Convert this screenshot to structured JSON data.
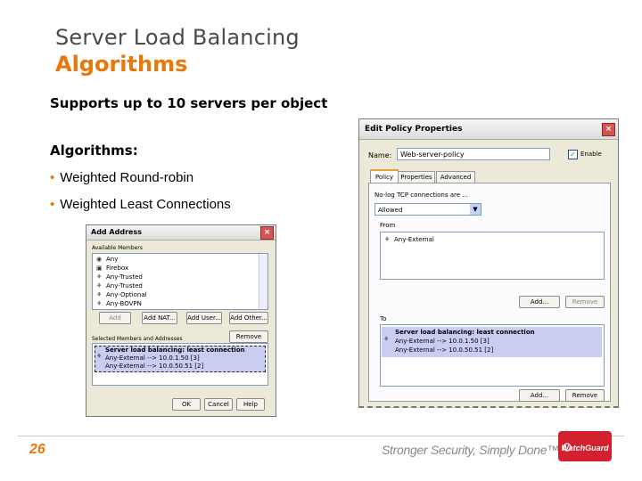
{
  "slide": {
    "title_line1": "Server Load Balancing",
    "title_line2": "Algorithms",
    "subtitle": "Supports up to 10 servers per object",
    "algorithms_heading": "Algorithms:",
    "bullets": [
      "Weighted Round-robin",
      "Weighted Least Connections"
    ],
    "page_number": "26",
    "tagline": "Stronger Security, Simply Done™",
    "accent_color": "#e8780c"
  },
  "add_address": {
    "title": "Add Address",
    "available_label": "Available Members",
    "members": [
      "Any",
      "Firebox",
      "Any-Trusted",
      "Any-Trusted",
      "Any-Optional",
      "Any-BOVPN"
    ],
    "buttons": {
      "add": "Add",
      "add_nat": "Add NAT...",
      "add_user": "Add User...",
      "add_other": "Add Other...",
      "remove": "Remove",
      "ok": "OK",
      "cancel": "Cancel",
      "help": "Help"
    },
    "selected_label": "Selected Members and Addresses",
    "selected_rows": [
      "Server load balancing: least connection",
      "Any-External --> 10.0.1.50 [3]",
      "Any-External --> 10.0.50.51 [2]"
    ]
  },
  "policy_props": {
    "title": "Edit Policy Properties",
    "name_label": "Name:",
    "name_value": "Web-server-policy",
    "enable_label": "Enable",
    "tabs": [
      "Policy",
      "Properties",
      "Advanced"
    ],
    "conn_label": "No-log TCP connections are ...",
    "conn_value": "Allowed",
    "from_label": "From",
    "from_items": [
      "Any-External"
    ],
    "to_label": "To",
    "to_items": [
      "Server load balancing: least connection",
      "Any-External --> 10.0.1.50 [3]",
      "Any-External --> 10.0.50.51 [2]"
    ],
    "buttons": {
      "add": "Add...",
      "remove": "Remove"
    }
  }
}
